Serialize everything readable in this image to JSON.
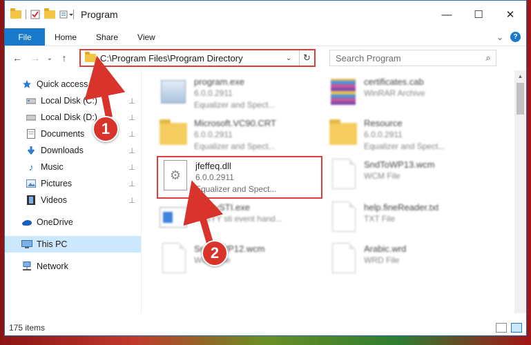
{
  "window": {
    "title": "Program",
    "controls": {
      "minimize": "—",
      "maximize": "☐",
      "close": "✕"
    }
  },
  "ribbon": {
    "tabs": [
      "File",
      "Home",
      "Share",
      "View"
    ],
    "expand_glyph": "⌄",
    "help": "?"
  },
  "address": {
    "path": "C:\\Program Files\\Program Directory",
    "dropdown": "⌄",
    "refresh": "↻"
  },
  "nav": {
    "back": "←",
    "forward": "→",
    "recent": "⌄",
    "up": "↑"
  },
  "search": {
    "placeholder": "Search Program",
    "icon": "⌕"
  },
  "sidebar": {
    "quick_access": "Quick access",
    "pinned": [
      {
        "label": "Local Disk (C:)",
        "icon": "drive-icon"
      },
      {
        "label": "Local Disk (D:)",
        "icon": "drive-icon"
      },
      {
        "label": "Documents",
        "icon": "documents-icon"
      },
      {
        "label": "Downloads",
        "icon": "downloads-icon"
      },
      {
        "label": "Music",
        "icon": "music-icon"
      },
      {
        "label": "Pictures",
        "icon": "pictures-icon"
      },
      {
        "label": "Videos",
        "icon": "videos-icon"
      }
    ],
    "onedrive": "OneDrive",
    "this_pc": "This PC",
    "network": "Network",
    "pin_glyph": "📌"
  },
  "files": [
    {
      "name": "program.exe",
      "line2": "6.0.0.2911",
      "line3": "Equalizer and Spect...",
      "icon": "exe-icon"
    },
    {
      "name": "certificates.cab",
      "line2": "WinRAR Archive",
      "line3": "",
      "icon": "rar-icon"
    },
    {
      "name": "Microsoft.VC90.CRT",
      "line2": "6.0.0.2911",
      "line3": "Equalizer and Spect...",
      "icon": "folder-icon"
    },
    {
      "name": "Resource",
      "line2": "6.0.0.2911",
      "line3": "Equalizer and Spect...",
      "icon": "folder-icon"
    },
    {
      "name": "jfeffeq.dll",
      "line2": "6.0.0.2911",
      "line3": "Equalizer and Spect...",
      "icon": "dll-gear-icon"
    },
    {
      "name": "SndToWP13.wcm",
      "line2": "WCM File",
      "line3": "",
      "icon": "document-icon"
    },
    {
      "name": "AbbyySTI.exe",
      "line2": "ABBYY sti event hand...",
      "line3": "",
      "icon": "app-icon"
    },
    {
      "name": "help.fineReader.txt",
      "line2": "TXT File",
      "line3": "",
      "icon": "document-icon"
    },
    {
      "name": "SndToWP12.wcm",
      "line2": "WCM File",
      "line3": "",
      "icon": "document-icon"
    },
    {
      "name": "Arabic.wrd",
      "line2": "WRD File",
      "line3": "",
      "icon": "document-icon"
    }
  ],
  "status": {
    "count": "175 items"
  },
  "callouts": {
    "one": "1",
    "two": "2"
  },
  "colors": {
    "accent": "#1979ca",
    "highlight": "#e23b3b",
    "callout": "#d9342b",
    "selected": "#cce8ff"
  }
}
